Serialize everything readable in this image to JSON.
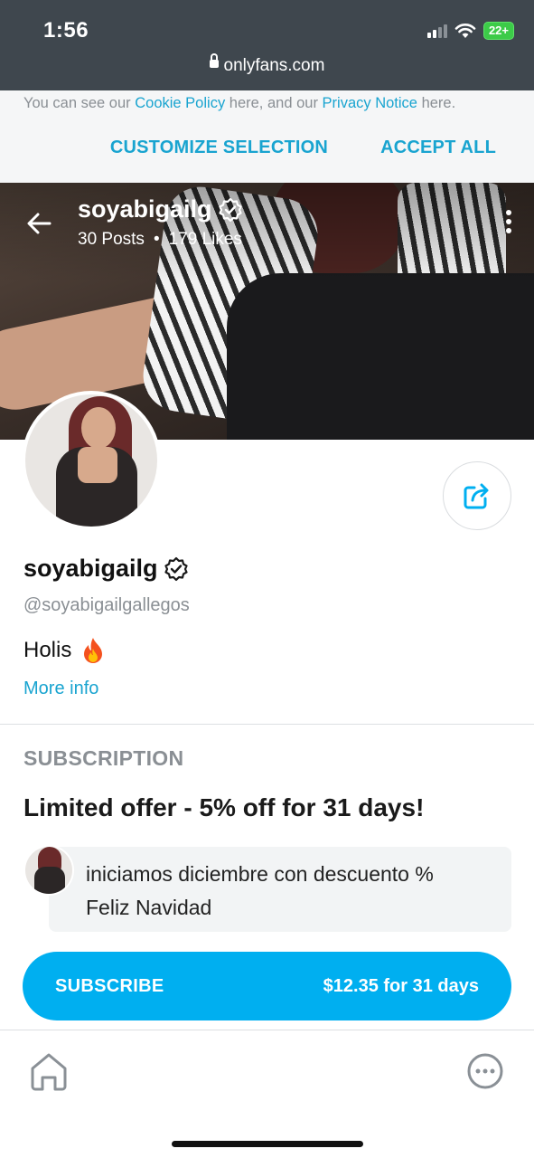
{
  "status_bar": {
    "time": "1:56",
    "battery": "22+",
    "url": "onlyfans.com"
  },
  "cookie_banner": {
    "text_prefix": "You can see our ",
    "cookie_link": "Cookie Policy",
    "text_middle": " here, and our ",
    "privacy_link": "Privacy Notice",
    "text_suffix": " here.",
    "customize_label": "CUSTOMIZE SELECTION",
    "accept_label": "ACCEPT ALL"
  },
  "cover": {
    "name": "soyabigailg",
    "posts": "30 Posts",
    "separator": "•",
    "likes": "179 Likes"
  },
  "profile": {
    "name": "soyabigailg",
    "handle": "@soyabigailgallegos",
    "bio": "Holis",
    "bio_emoji": "fire-emoji",
    "more_info": "More info"
  },
  "subscription": {
    "title": "SUBSCRIPTION",
    "offer": "Limited offer - 5% off for 31 days!",
    "message_line1": "iniciamos diciembre con descuento %",
    "message_line2": "Feliz Navidad",
    "button_label": "SUBSCRIBE",
    "button_price": "$12.35 for 31 days"
  },
  "bottom_nav": {
    "home_icon": "home-icon",
    "more_icon": "more-options-icon"
  },
  "colors": {
    "accent": "#00aff0",
    "link": "#19a4d0",
    "chrome": "#3f474e"
  }
}
